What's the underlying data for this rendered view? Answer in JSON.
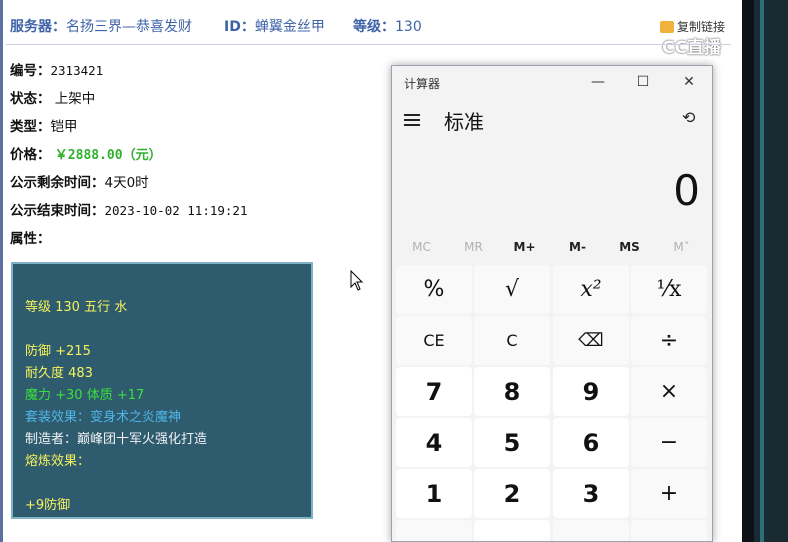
{
  "header": {
    "server_label": "服务器：",
    "server_value": "名扬三界—恭喜发财",
    "id_label": "ID：",
    "id_value": "蝉翼金丝甲",
    "level_label": "等级：",
    "level_value": "130",
    "copy_link": "复制链接",
    "watermark": "CC直播"
  },
  "info": {
    "number_label": "编号：",
    "number_value": "2313421",
    "status_label": "状态：",
    "status_value": "上架中",
    "type_label": "类型：",
    "type_value": "铠甲",
    "price_label": "价格：",
    "price_value": "￥2888.00（元）",
    "remain_label": "公示剩余时间：",
    "remain_value": "4天0时",
    "end_label": "公示结束时间：",
    "end_value": "2023-10-02 11:19:21",
    "attr_label": "属性："
  },
  "tooltip": {
    "line1": "等级 130 五行 水",
    "line2": "防御 +215",
    "line3": "耐久度 483",
    "line4": "魔力 +30 体质 +17",
    "line5": "套装效果：变身术之炎魔神",
    "line6": "制造者：巅峰团十军火强化打造",
    "line7": "熔炼效果：",
    "line8": "+9防御",
    "colors": {
      "yellow": "#f4f25c",
      "green": "#3be03b",
      "cyan": "#4fb6e8",
      "white": "#f2f2f2"
    }
  },
  "calculator": {
    "title": "计算器",
    "mode": "标准",
    "display": "0",
    "memory": [
      "MC",
      "MR",
      "M+",
      "M-",
      "MS",
      "M˅"
    ],
    "keys": {
      "percent": "%",
      "sqrt": "√",
      "square": "x²",
      "reciprocal": "⅟x",
      "ce": "CE",
      "c": "C",
      "backspace": "⌫",
      "divide": "÷",
      "seven": "7",
      "eight": "8",
      "nine": "9",
      "multiply": "×",
      "four": "4",
      "five": "5",
      "six": "6",
      "minus": "−",
      "one": "1",
      "two": "2",
      "three": "3",
      "plus": "+"
    }
  }
}
